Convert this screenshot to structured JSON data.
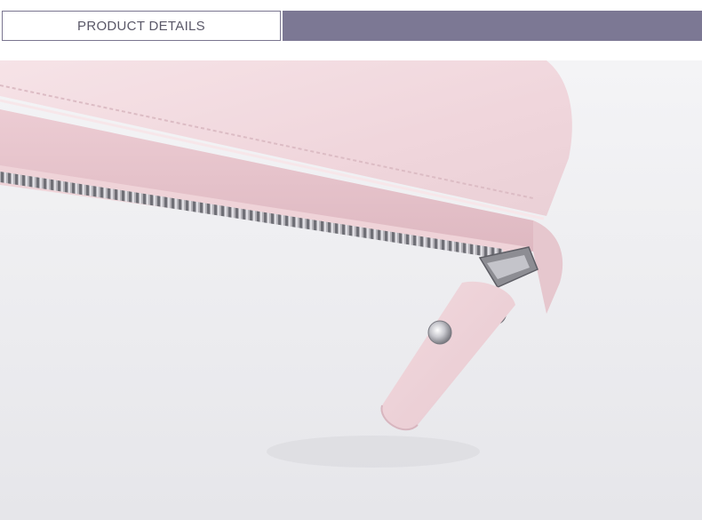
{
  "header": {
    "label": "PRODUCT DETAILS",
    "accent_color": "#7c7894"
  },
  "photo": {
    "subject": "pink-leather-wallet-zipper-closeup",
    "colors": {
      "background": "#e9e9ec",
      "leather": "#f1d8de",
      "leather_shadow": "#e2c1ca",
      "zipper_tape": "#efd3d8",
      "metal": "#8d8d93"
    }
  }
}
